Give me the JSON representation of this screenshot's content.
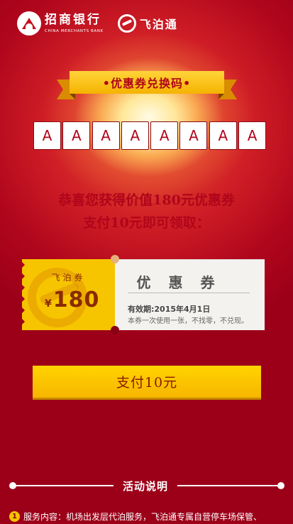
{
  "header": {
    "bank_name_cn": "招商银行",
    "bank_name_en": "CHINA MERCHANTS BANK",
    "partner_name": "飞泊通"
  },
  "ribbon": {
    "title": "•优惠券兑换码•"
  },
  "redeem_code": [
    "A",
    "A",
    "A",
    "A",
    "A",
    "A",
    "A",
    "A"
  ],
  "message": {
    "line1": "恭喜您获得价值180元优惠券",
    "line2": "支付10元即可领取："
  },
  "coupon": {
    "brand": "飞泊券",
    "currency": "¥",
    "amount": "180",
    "title": "优 惠 券",
    "validity": "有效期:2015年4月1日",
    "rule": "本券一次使用一张，不找零，不兑现。"
  },
  "pay_button": {
    "label": "支付10元"
  },
  "activity": {
    "title": "活动说明",
    "items": [
      {
        "index": "1",
        "text": "服务内容：机场出发层代泊服务，飞泊通专属自营停车场保管、"
      }
    ]
  },
  "colors": {
    "background": "#b0061c",
    "accent_yellow": "#f7c500",
    "brand_red": "#b0051a"
  }
}
